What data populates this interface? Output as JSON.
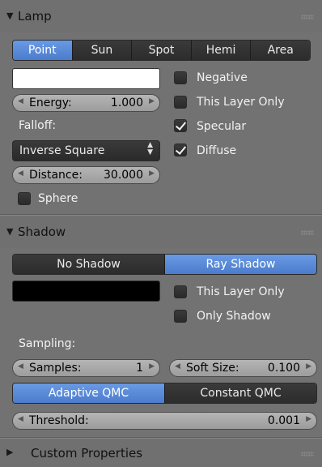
{
  "lamp_panel": {
    "title": "Lamp",
    "collapse_icon": "triangle-down",
    "lamp_types": [
      "Point",
      "Sun",
      "Spot",
      "Hemi",
      "Area"
    ],
    "lamp_type_selected": "Point",
    "color_swatch": "#ffffff",
    "energy": {
      "label": "Energy:",
      "value": "1.000"
    },
    "falloff_label": "Falloff:",
    "falloff_value": "Inverse Square",
    "distance": {
      "label": "Distance:",
      "value": "30.000"
    },
    "sphere": {
      "label": "Sphere",
      "checked": false
    },
    "negative": {
      "label": "Negative",
      "checked": false
    },
    "this_layer_only": {
      "label": "This Layer Only",
      "checked": false
    },
    "specular": {
      "label": "Specular",
      "checked": true
    },
    "diffuse": {
      "label": "Diffuse",
      "checked": true
    }
  },
  "shadow_panel": {
    "title": "Shadow",
    "collapse_icon": "triangle-down",
    "shadow_modes": [
      "No Shadow",
      "Ray Shadow"
    ],
    "shadow_mode_selected": "Ray Shadow",
    "color_swatch": "#000000",
    "this_layer_only": {
      "label": "This Layer Only",
      "checked": false
    },
    "only_shadow": {
      "label": "Only Shadow",
      "checked": false
    },
    "sampling_label": "Sampling:",
    "samples": {
      "label": "Samples:",
      "value": "1"
    },
    "soft_size": {
      "label": "Soft Size:",
      "value": "0.100"
    },
    "sampling_methods": [
      "Adaptive QMC",
      "Constant QMC"
    ],
    "sampling_method_selected": "Adaptive QMC",
    "threshold": {
      "label": "Threshold:",
      "value": "0.001"
    }
  },
  "custom_props_panel": {
    "title": "Custom Properties",
    "collapse_icon": "triangle-right"
  },
  "colors": {
    "background": "#727272",
    "accent_blue": "#5680d8",
    "button_dark": "#2e2e2e",
    "field_gray": "#a8a8a8"
  }
}
